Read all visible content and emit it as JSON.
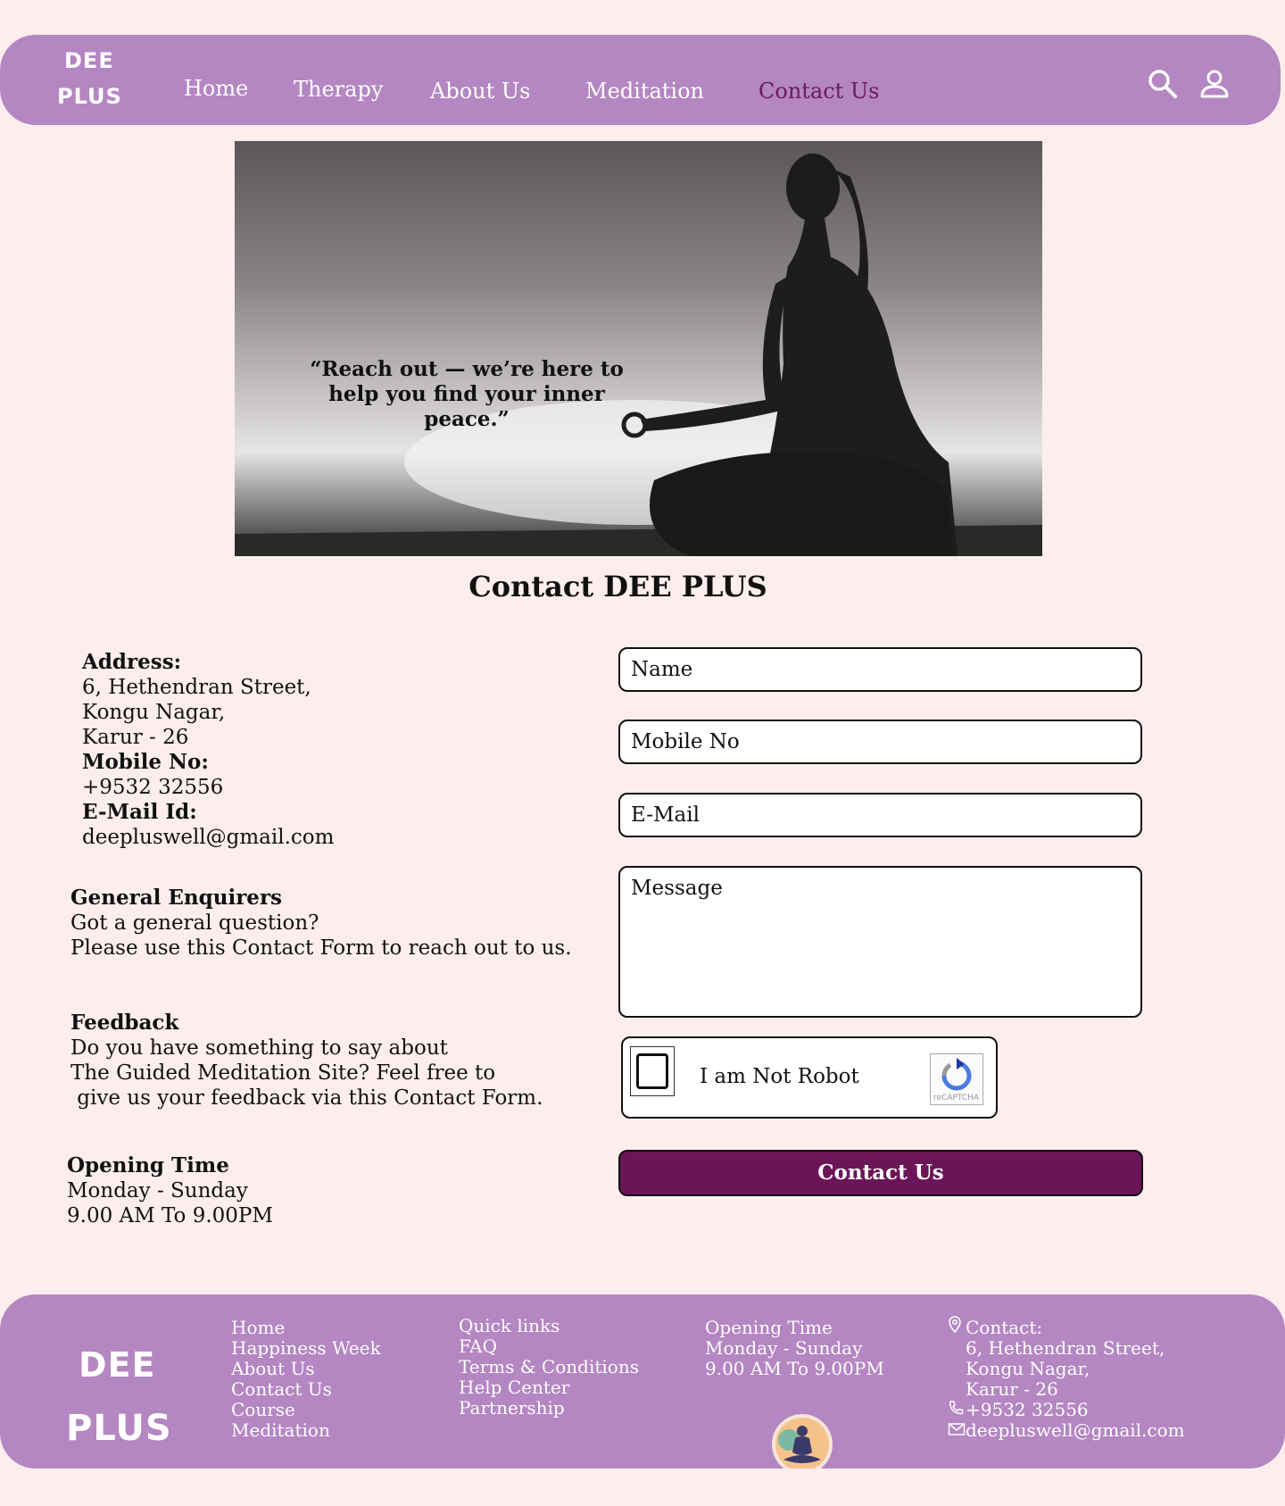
{
  "brand": {
    "logo_top": "DEE",
    "logo_bottom": "PLUS"
  },
  "nav": {
    "items": [
      {
        "label": "Home",
        "active": false
      },
      {
        "label": "Therapy",
        "active": false
      },
      {
        "label": "About Us",
        "active": false
      },
      {
        "label": "Meditation",
        "active": false
      },
      {
        "label": "Contact Us",
        "active": true
      }
    ],
    "icons": [
      "search-icon",
      "user-icon"
    ]
  },
  "hero": {
    "quote_line1": "“Reach out — we’re here to",
    "quote_line2": "help you find your inner peace.”"
  },
  "page_title": "Contact DEE PLUS",
  "info": {
    "address_label": "Address:",
    "address_lines": [
      "6, Hethendran Street,",
      "Kongu Nagar,",
      "Karur - 26"
    ],
    "mobile_label": "Mobile No:",
    "mobile": "+9532 32556",
    "email_label": "E-Mail Id:",
    "email": "deepluswell@gmail.com",
    "general_title": "General Enquirers",
    "general_lines": [
      "Got a general question?",
      "Please use this Contact Form to reach out to us."
    ],
    "feedback_title": "Feedback",
    "feedback_lines": [
      "Do you have something to say about",
      "The Guided Meditation Site? Feel free to",
      " give us your feedback via this Contact Form."
    ],
    "opening_title": "Opening Time",
    "opening_lines": [
      "Monday - Sunday",
      "9.00 AM To 9.00PM"
    ]
  },
  "form": {
    "name_placeholder": "Name",
    "mobile_placeholder": "Mobile No",
    "email_placeholder": "E-Mail",
    "message_placeholder": "Message",
    "captcha_label": "I am Not Robot",
    "captcha_brand": "reCAPTCHA",
    "submit_label": "Contact Us"
  },
  "footer": {
    "col1": [
      "Home",
      "Happiness Week",
      "About Us",
      "Contact Us",
      "Course",
      "Meditation"
    ],
    "col2": [
      "Quick links",
      "FAQ",
      "Terms & Conditions",
      "Help Center",
      "Partnership"
    ],
    "col3": [
      "Opening Time",
      "Monday - Sunday",
      "9.00 AM To 9.00PM"
    ],
    "contact_label": "Contact:",
    "contact_lines": [
      "6, Hethendran Street,",
      "Kongu Nagar,",
      "Karur - 26"
    ],
    "phone": "+9532 32556",
    "email": "deepluswell@gmail.com"
  },
  "colors": {
    "background": "#fdeeed",
    "nav": "#b486c2",
    "accent": "#6b1a5e",
    "button": "#6b1558"
  }
}
